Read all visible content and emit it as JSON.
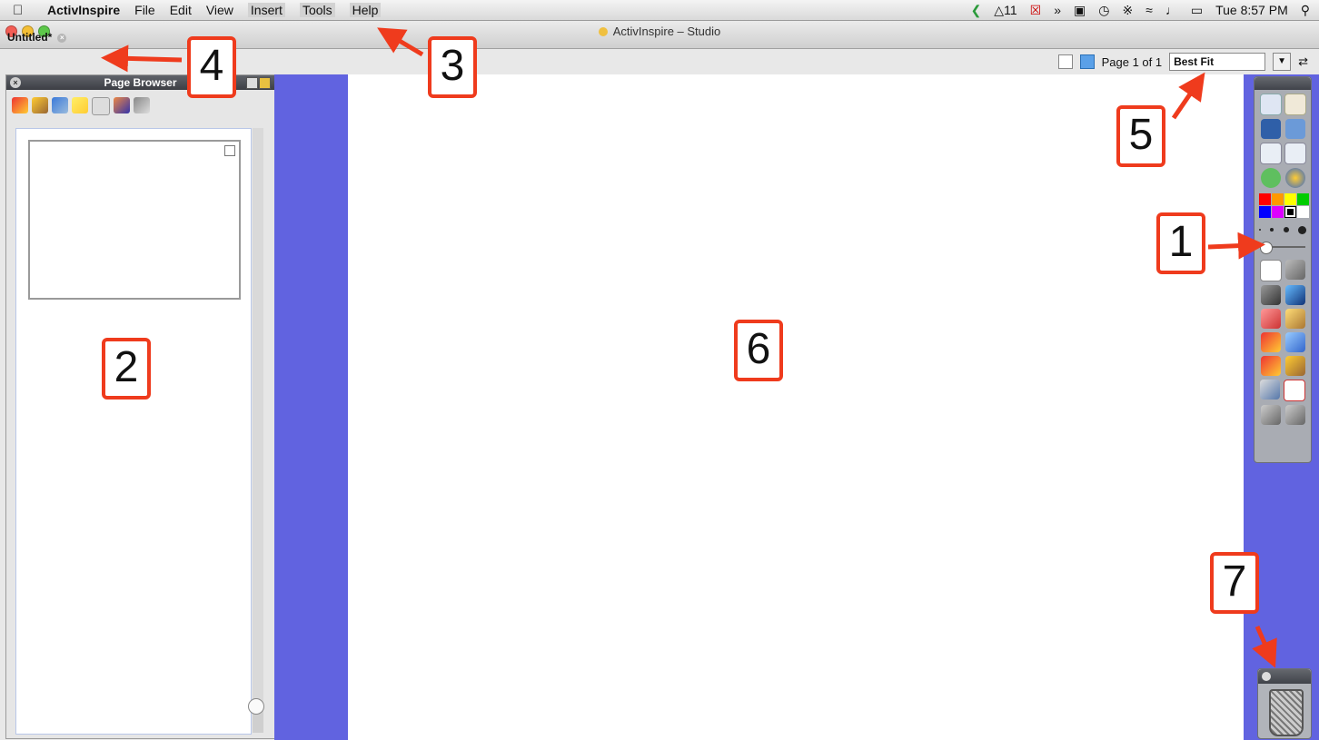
{
  "menubar": {
    "app_name": "ActivInspire",
    "items": [
      "File",
      "Edit",
      "View",
      "Insert",
      "Tools",
      "Help"
    ],
    "status_number": "11",
    "clock": "Tue 8:57 PM"
  },
  "window": {
    "title": "ActivInspire – Studio"
  },
  "document_tab": {
    "label": "Untitled*"
  },
  "page_nav": {
    "page_text": "Page 1 of 1",
    "zoom_value": "Best Fit"
  },
  "page_browser": {
    "title": "Page Browser"
  },
  "annotations": [
    "1",
    "2",
    "3",
    "4",
    "5",
    "6",
    "7"
  ]
}
